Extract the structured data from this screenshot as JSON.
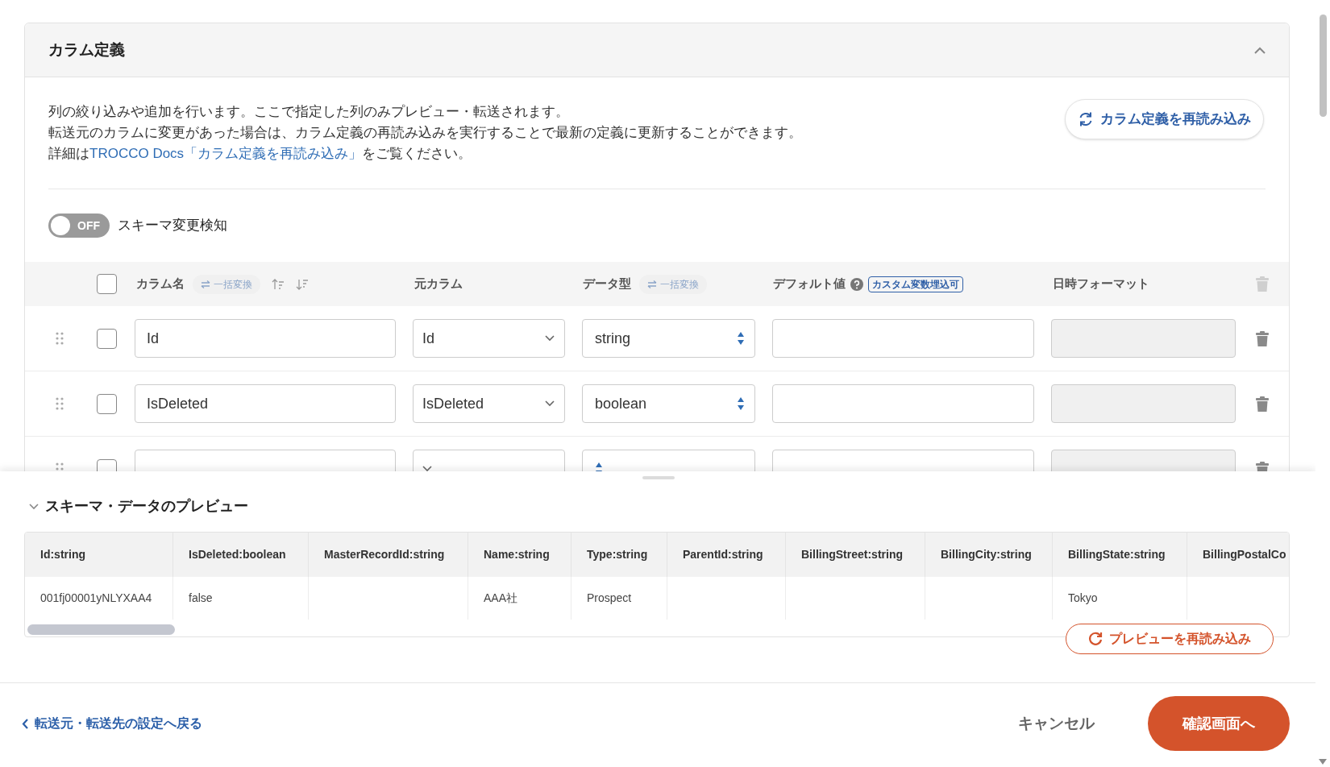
{
  "section": {
    "title": "カラム定義",
    "expanded": true,
    "description": [
      "列の絞り込みや追加を行います。ここで指定した列のみプレビュー・転送されます。",
      "転送元のカラムに変更があった場合は、カラム定義の再読み込みを実行することで最新の定義に更新することができます。"
    ],
    "docs_line": {
      "before": "詳細は",
      "link": "TROCCO Docs「カラム定義を再読み込み」",
      "after": "をご覧ください。"
    },
    "reload_button": "カラム定義を再読み込み",
    "schema_toggle": {
      "on": false,
      "state_label": "OFF",
      "label": "スキーマ変更検知"
    },
    "table": {
      "select_all_checked": false,
      "name_label": "カラム名",
      "name_bulk": "一括変換",
      "source_label": "元カラム",
      "type_label": "データ型",
      "type_bulk": "一括変換",
      "default_label": "デフォルト値",
      "default_badge": "カスタム変数埋込可",
      "format_label": "日時フォーマット",
      "rows": [
        {
          "checked": false,
          "name": "Id",
          "source": "Id",
          "type": "string",
          "format_disabled": true
        },
        {
          "checked": false,
          "name": "IsDeleted",
          "source": "IsDeleted",
          "type": "boolean",
          "format_disabled": true
        },
        {
          "checked": false,
          "format_disabled": true
        }
      ]
    }
  },
  "preview": {
    "title": "スキーマ・データのプレビュー",
    "expanded": true,
    "columns": [
      "Id:string",
      "IsDeleted:boolean",
      "MasterRecordId:string",
      "Name:string",
      "Type:string",
      "ParentId:string",
      "BillingStreet:string",
      "BillingCity:string",
      "BillingState:string",
      "BillingPostalCo"
    ],
    "rows": [
      [
        "001fj00001yNLYXAA4",
        "false",
        null,
        "AAA社",
        "Prospect",
        null,
        null,
        null,
        "Tokyo",
        null
      ]
    ],
    "reload_button": "プレビューを再読み込み"
  },
  "footer": {
    "back_link": "転送元・転送先の設定へ戻る",
    "cancel": "キャンセル",
    "confirm": "確認画面へ"
  }
}
